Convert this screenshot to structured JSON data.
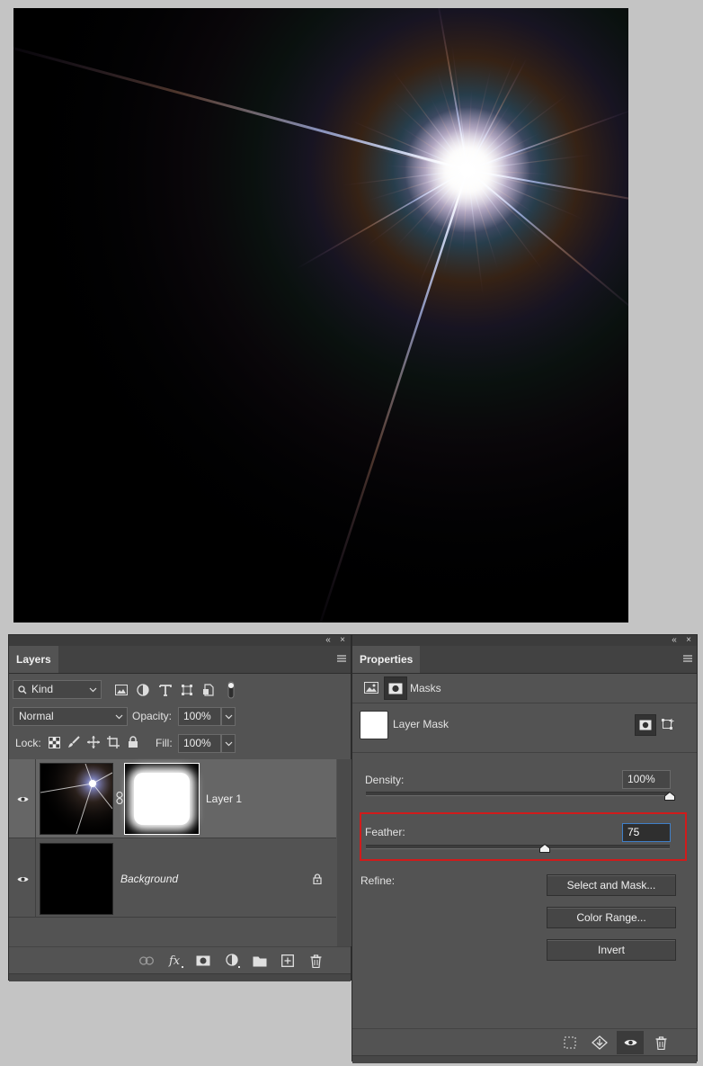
{
  "canvas": {
    "description": "starburst"
  },
  "layers_panel": {
    "tab_label": "Layers",
    "filter": {
      "kind_label": "Kind"
    },
    "blend_mode": "Normal",
    "opacity_label": "Opacity:",
    "opacity_value": "100%",
    "lock_label": "Lock:",
    "fill_label": "Fill:",
    "fill_value": "100%",
    "layers": [
      {
        "name": "Layer 1",
        "visible": true,
        "has_mask": true
      },
      {
        "name": "Background",
        "visible": true,
        "locked": true
      }
    ]
  },
  "properties_panel": {
    "tab_label": "Properties",
    "header_label": "Masks",
    "mask_type_label": "Layer Mask",
    "density_label": "Density:",
    "density_value": "100%",
    "density_fraction": 1.0,
    "feather_label": "Feather:",
    "feather_value": "75",
    "feather_fraction": 0.59,
    "refine_label": "Refine:",
    "buttons": {
      "select_and_mask": "Select and Mask...",
      "color_range": "Color Range...",
      "invert": "Invert"
    }
  }
}
